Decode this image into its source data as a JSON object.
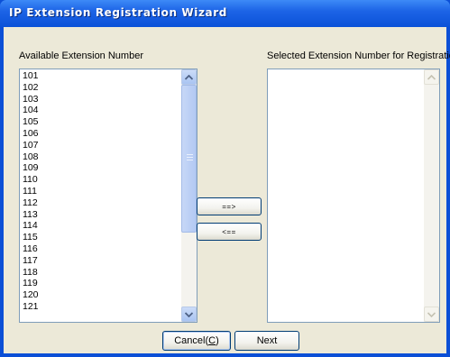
{
  "window": {
    "title": "IP Extension Registration Wizard"
  },
  "labels": {
    "available": "Available Extension Number",
    "selected": "Selected Extension Number for Registration"
  },
  "available_list": [
    "101",
    "102",
    "103",
    "104",
    "105",
    "106",
    "107",
    "108",
    "109",
    "110",
    "111",
    "112",
    "113",
    "114",
    "115",
    "116",
    "117",
    "118",
    "119",
    "120",
    "121"
  ],
  "selected_list": [],
  "buttons": {
    "add": "==>",
    "remove": "<==",
    "cancel": "Cancel(C)",
    "next": "Next"
  },
  "icons": {
    "scroll_up": "chevron-up-icon",
    "scroll_down": "chevron-down-icon"
  }
}
